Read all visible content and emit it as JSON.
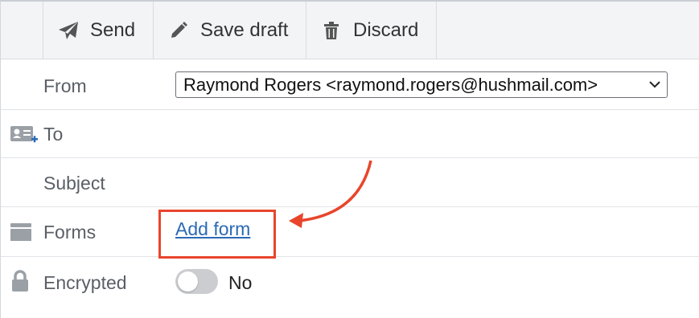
{
  "toolbar": {
    "send_label": "Send",
    "save_draft_label": "Save draft",
    "discard_label": "Discard"
  },
  "form": {
    "from_label": "From",
    "from_value": "Raymond Rogers <raymond.rogers@hushmail.com>",
    "to_label": "To",
    "subject_label": "Subject",
    "forms_label": "Forms",
    "add_form_link": "Add form",
    "encrypted_label": "Encrypted",
    "encrypted_value": "No"
  },
  "icons": {
    "send": "paper-plane-icon",
    "save_draft": "pencil-icon",
    "discard": "trash-icon",
    "to": "contact-card-add-icon",
    "forms": "form-window-icon",
    "encrypted": "lock-icon",
    "select_chevron": "chevron-down-icon"
  },
  "colors": {
    "toolbar_bg": "#f3f4f6",
    "link": "#2a6ab6",
    "highlight_annotation": "#e8452c",
    "toggle_off": "#cbcdd0"
  }
}
